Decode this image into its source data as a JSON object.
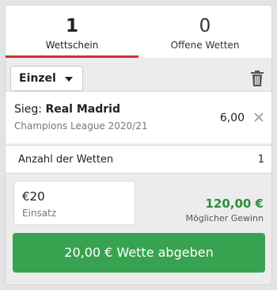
{
  "tabs": [
    {
      "count": "1",
      "label": "Wettschein"
    },
    {
      "count": "0",
      "label": "Offene Wetten"
    }
  ],
  "toolbar": {
    "bet_type": "Einzel",
    "icons": [
      "chevron-down-icon",
      "trash-icon"
    ]
  },
  "bet": {
    "prefix": "Sieg:",
    "team": "Real Madrid",
    "competition": "Champions League 2020/21",
    "odds": "6,00",
    "remove_icon": "close-icon"
  },
  "summary": {
    "count_label": "Anzahl der Wetten",
    "count_value": "1"
  },
  "stake": {
    "value": "€20",
    "label": "Einsatz"
  },
  "gain": {
    "amount": "120,00 €",
    "label": "Möglicher Gewinn"
  },
  "submit_label": "20,00 € Wette abgeben",
  "colors": {
    "accent_red": "#d0312d",
    "gain_green": "#2e8b3e",
    "button_green": "#37a350",
    "background": "#e4e4e4"
  }
}
